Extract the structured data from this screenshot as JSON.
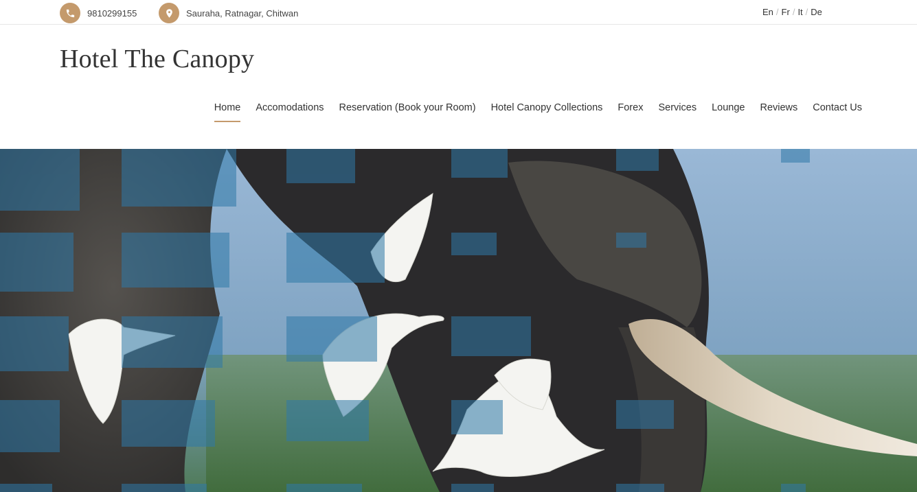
{
  "topbar": {
    "phone": "9810299155",
    "address": "Sauraha, Ratnagar, Chitwan",
    "phone_icon": "phone-icon",
    "location_icon": "map-pin-icon",
    "languages": [
      "En",
      "Fr",
      "It",
      "De"
    ],
    "language_separator": "/"
  },
  "header": {
    "site_title": "Hotel The Canopy"
  },
  "nav": {
    "items": [
      {
        "label": "Home"
      },
      {
        "label": "Accomodations"
      },
      {
        "label": "Reservation (Book your Room)"
      },
      {
        "label": "Hotel Canopy Collections"
      },
      {
        "label": "Forex"
      },
      {
        "label": "Services"
      },
      {
        "label": "Lounge"
      },
      {
        "label": "Reviews"
      },
      {
        "label": "Contact Us"
      }
    ],
    "active_item": "Home"
  },
  "colors": {
    "accent": "#c49a6c",
    "text": "#333333",
    "divider": "#e6e6e6",
    "sky": "#8fb0cf",
    "elephant": "#3a3a38",
    "grass": "#5d7d4a",
    "tusk": "#d8cbb6",
    "tile_overlay": "#2f79a8"
  }
}
